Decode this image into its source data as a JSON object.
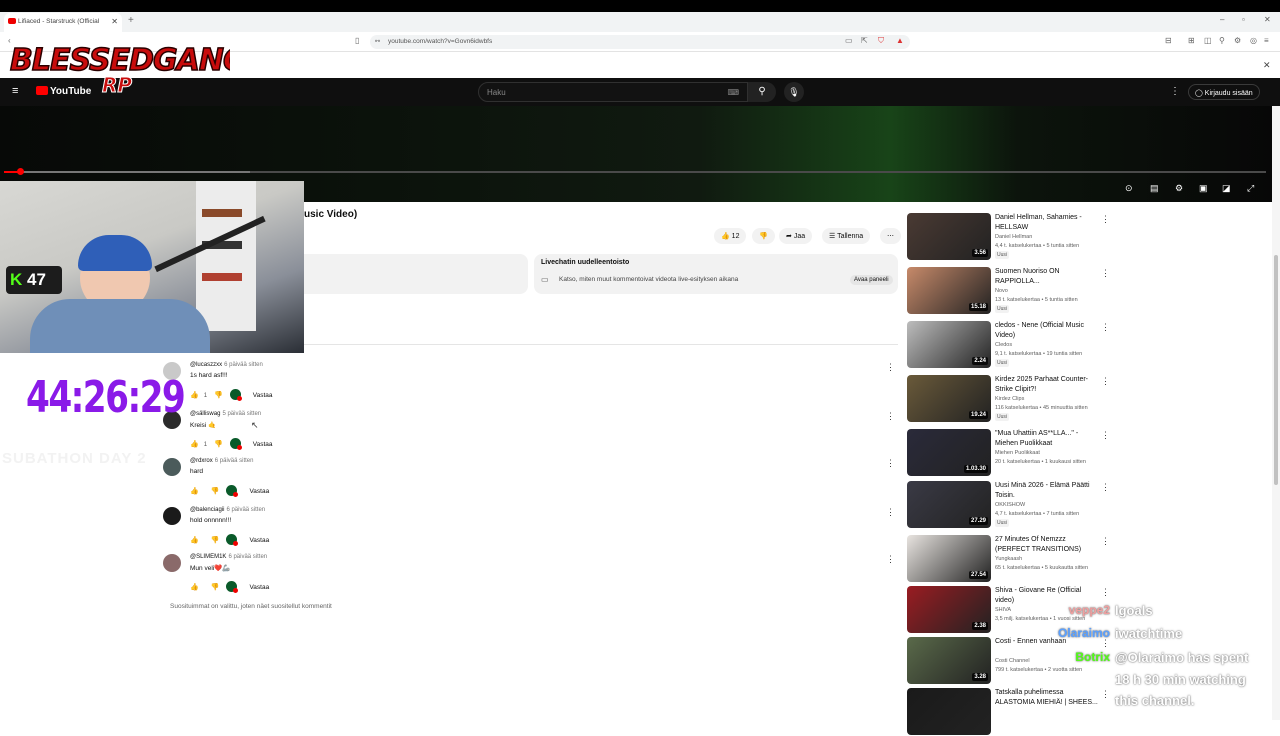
{
  "browser": {
    "tab_title": "Lifiaced - Starstruck (Official ",
    "url": "youtube.com/watch?v=Govn6idwbfs"
  },
  "youtube": {
    "logo_text": "YouTube",
    "search_placeholder": "Haku",
    "sign_in_label": "Kirjaudu sisään",
    "video_title_partial": "usic Video)",
    "like_count": "12",
    "share_label": "Jaa",
    "save_label": "Tallenna",
    "live_chat": {
      "title": "Livechatin uudelleentoisto",
      "desc": "Katso, miten muut kommentoivat videota live-esityksen aikana",
      "open_label": "Avaa paneeli"
    },
    "comments": [
      {
        "user": "@lucaszzxx",
        "ago": "6 päivää sitten",
        "text": "1s hard asf!!!",
        "likes": "1",
        "reply": "Vastaa",
        "avatar": "#c9c9c9"
      },
      {
        "user": "@sälliswag",
        "ago": "5 päivää sitten",
        "text": "Kreisi 🤙",
        "likes": "1",
        "reply": "Vastaa",
        "avatar": "#2b2b2b"
      },
      {
        "user": "@rdxrox",
        "ago": "6 päivää sitten",
        "text": "hard",
        "likes": "",
        "reply": "Vastaa",
        "avatar": "#4b5b5b"
      },
      {
        "user": "@balenciagii",
        "ago": "6 päivää sitten",
        "text": "hold onnnnn!!!",
        "likes": "",
        "reply": "Vastaa",
        "avatar": "#1a1a1a"
      },
      {
        "user": "@SLIMEM1K",
        "ago": "6 päivää sitten",
        "text": "Mun veli❤️🦾",
        "likes": "",
        "reply": "Vastaa",
        "avatar": "#8a6a6a"
      }
    ],
    "comments_note": "Suosituimmat on valittu, joten näet suositellut kommentit",
    "recommendations": [
      {
        "title": "Daniel Hellman, Sahamies - HELLSAW",
        "channel": "Daniel Hellman",
        "meta": "4,4 t. katselukertaa • 5 tuntia sitten",
        "badge": "Uusi",
        "duration": "3.56",
        "thumb": "#4a3a33"
      },
      {
        "title": "Suomen Nuoriso ON RAPPIOLLA...",
        "channel": "Novo",
        "meta": "13 t. katselukertaa • 5 tuntia sitten",
        "badge": "Uusi",
        "duration": "15.18",
        "thumb": "#c78a6a"
      },
      {
        "title": "cledos - Nene (Official Music Video)",
        "channel": "Cledos",
        "meta": "9,1 t. katselukertaa • 19 tuntia sitten",
        "badge": "Uusi",
        "duration": "2.24",
        "thumb": "#bdbdbd"
      },
      {
        "title": "Kirdez 2025 Parhaat Counter-Strike Clipit?!",
        "channel": "Kirdez Clips",
        "meta": "116 katselukertaa • 45 minuuttia sitten",
        "badge": "Uusi",
        "duration": "19.24",
        "thumb": "#6a5a3a"
      },
      {
        "title": "\"Mua Uhattiin AS**LLA...\" - Miehen Puolikkaat",
        "channel": "Miehen Puolikkaat",
        "meta": "20 t. katselukertaa • 1 kuukausi sitten",
        "badge": "",
        "duration": "1.03.30",
        "thumb": "#2a2a3a"
      },
      {
        "title": "Uusi Minä 2026 - Elämä Päätti Toisin.",
        "channel": "OKKISHOW",
        "meta": "4,7 t. katselukertaa • 7 tuntia sitten",
        "badge": "Uusi",
        "duration": "27.29",
        "thumb": "#3a3a45"
      },
      {
        "title": "27 Minutes Of Nemzzz (PERFECT TRANSITIONS)",
        "channel": "Yungkaash",
        "meta": "65 t. katselukertaa • 5 kuukautta sitten",
        "badge": "",
        "duration": "27.54",
        "thumb": "#e8e4e0"
      },
      {
        "title": "Shiva - Giovane Re (Official video)",
        "channel": "SHIVA",
        "meta": "3,5 milj. katselukertaa • 1 vuosi sitten",
        "badge": "",
        "duration": "2.38",
        "thumb": "#9a1c22"
      },
      {
        "title": "Costi - Ennen vanhaan",
        "channel": "Costi Channel",
        "meta": "799 t. katselukertaa • 2 vuotta sitten",
        "badge": "",
        "duration": "3.28",
        "thumb": "#5a6a4a"
      },
      {
        "title": "Tatskalla puhelimessa ALASTOMIA MIEHIÄ! | SHEES...",
        "channel": "",
        "meta": "",
        "badge": "",
        "duration": "",
        "thumb": "#1a1a1a"
      }
    ]
  },
  "stream_overlay": {
    "logo_text": "BLESSEDGANG RP",
    "kick_count": "47",
    "timer": "44:26:29",
    "ghost_text": "SUBATHON DAY 2",
    "chat": [
      {
        "user": "veppe2",
        "msg": "lgoals",
        "color": "#f0a0a0"
      },
      {
        "user": "Olaraimo",
        "msg": "iwatchtime",
        "color": "#5aa0ff"
      },
      {
        "user": "Botrix",
        "msg": "@Olaraimo has spent",
        "color": "#53fc18"
      },
      {
        "user": "",
        "msg": "18 h 30 min watching",
        "color": ""
      },
      {
        "user": "",
        "msg": "this channel.",
        "color": ""
      }
    ]
  }
}
